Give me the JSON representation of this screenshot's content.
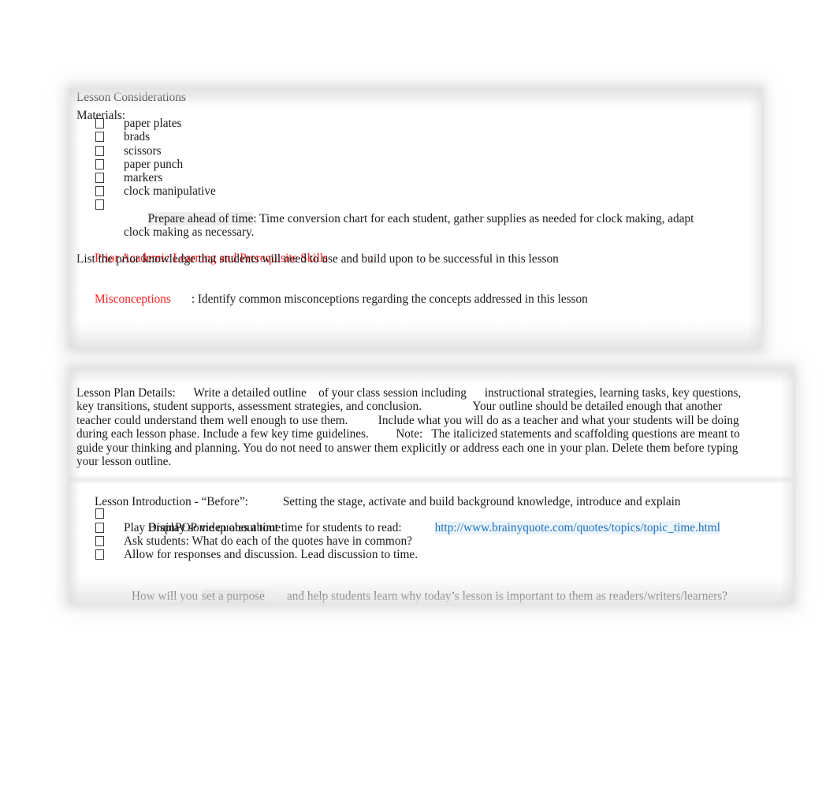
{
  "document": {
    "section_one": {
      "heading": "Lesson Considerations",
      "materials_label": "Materials:",
      "materials": [
        "paper plates",
        "brads",
        "scissors",
        "paper punch",
        "markers",
        "clock manipulative"
      ],
      "prepare_bullet": {
        "highlight": "Prepare ahead of time",
        "rest": ": Time conversion chart for each student, gather supplies as needed for clock making, adapt clock making as necessary."
      },
      "prior_learning": {
        "heading": "Prior Academic Learning and Prerequisite Skills",
        "colon": ":",
        "body": "List the prior knowledge that students will need to use and build upon to be successful in this lesson"
      },
      "misconceptions": {
        "heading": "Misconceptions",
        "body": ": Identify common misconceptions regarding the concepts addressed in this lesson"
      }
    },
    "section_two": {
      "details_paragraph": "Lesson Plan Details:      Write a detailed outline    of your class session including      instructional strategies, learning tasks, key questions, key transitions, student supports, assessment strategies, and conclusion.                 Your outline should be detailed enough that another teacher could understand them well enough to use them.          Include what you will do as a teacher and what your students will be doing during each lesson phase. Include a few key time guidelines.         Note:   The italicized statements and scaffolding questions are meant to guide your thinking and planning. You do not need to answer them explicitly or address each one in your plan. Delete them before typing your lesson outline.",
      "introduction_heading": "Lesson Introduction - “Before”:",
      "introduction_desc": "Setting the stage, activate and build background knowledge, introduce and explain",
      "intro_bullet_one_text": "Display some quotes about time for students to read:",
      "intro_bullet_one_link": "http://www.brainyquote.com/quotes/topics/topic_time.html",
      "intro_bullets": [
        "Play BrainPOP video about time",
        "Ask students: What do each of the quotes have in common?",
        "Allow for responses and discussion. Lead discussion to time."
      ],
      "closing_question": {
        "lead": "How will you",
        "highlight": "set a purpose",
        "rest": "and help students learn why today’s lesson is important to them as readers/writers/learners?"
      }
    }
  },
  "colors": {
    "red_heading": "#ff1d1d",
    "link_blue": "#2272c4",
    "body_text": "#1a1a1a",
    "page_background": "#ffffff"
  }
}
